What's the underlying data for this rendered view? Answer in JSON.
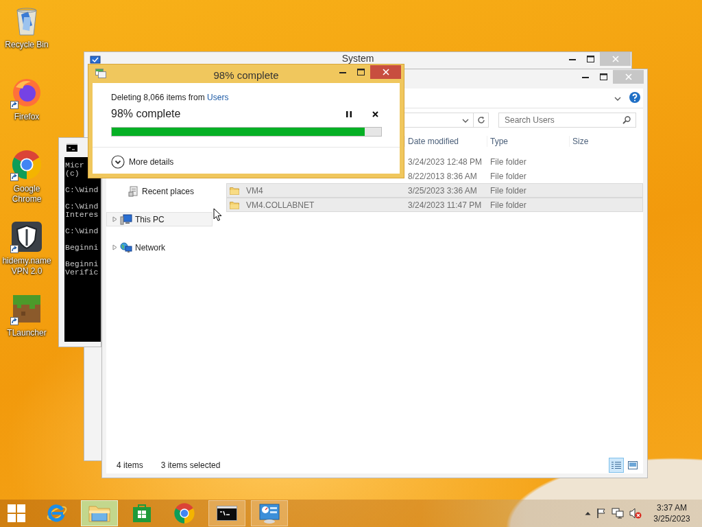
{
  "desktop_icons": [
    {
      "kind": "recycle-bin",
      "label": "Recycle Bin",
      "shortcut": false
    },
    {
      "kind": "firefox",
      "label": "Firefox",
      "shortcut": true
    },
    {
      "kind": "chrome",
      "label": "Google Chrome",
      "shortcut": true
    },
    {
      "kind": "vpn",
      "label": "hidemy.name VPN 2.0",
      "shortcut": true
    },
    {
      "kind": "tlauncher",
      "label": "TLauncher",
      "shortcut": true
    }
  ],
  "system_window": {
    "title": "System",
    "active": false
  },
  "console_window": {
    "active": false,
    "paragraphs": [
      [
        "Micr",
        "(c) "
      ],
      [
        "C:\\Wind"
      ],
      [
        "C:\\Wind",
        "Interes"
      ],
      [
        "C:\\Wind"
      ],
      [
        "Beginni"
      ],
      [
        "Beginni",
        "Verific"
      ]
    ]
  },
  "explorer": {
    "active": false,
    "search": {
      "placeholder": "Search Users"
    },
    "nav": [
      {
        "kind": "favorite",
        "label": "Recent places",
        "hovered": false
      },
      {
        "kind": "root",
        "label": "This PC",
        "expanded": false,
        "hovered": true
      },
      {
        "kind": "root",
        "label": "Network",
        "expanded": false,
        "hovered": false
      }
    ],
    "columns": [
      "Date modified",
      "Type",
      "Size"
    ],
    "rows": [
      {
        "date": "3/24/2023 12:48 PM",
        "type": "File folder",
        "selected": false
      },
      {
        "date": "8/22/2013 8:36 AM",
        "type": "File folder",
        "selected": false
      },
      {
        "name": "VM4",
        "date": "3/25/2023 3:36 AM",
        "type": "File folder",
        "selected": true
      },
      {
        "name": "VM4.COLLABNET",
        "date": "3/24/2023 11:47 PM",
        "type": "File folder",
        "selected": true
      }
    ],
    "status": {
      "count": "4 items",
      "selection": "3 items selected"
    },
    "view_buttons": [
      {
        "kind": "details",
        "selected": true
      },
      {
        "kind": "large-icons",
        "selected": false
      }
    ]
  },
  "dialog": {
    "active": true,
    "title": "98% complete",
    "message": "Deleting 8,066 items from",
    "source": "Users",
    "status": "98% complete",
    "progress": {
      "level": 0.94
    },
    "more_details": "More details"
  },
  "taskbar": {
    "apps": [
      {
        "open": false,
        "active": false
      },
      {
        "open": true,
        "active": true
      },
      {
        "open": false,
        "active": false
      },
      {
        "open": false,
        "active": false
      },
      {
        "open": true,
        "active": false
      },
      {
        "open": true,
        "active": false
      }
    ],
    "volume_muted": true,
    "clock": {
      "time": "3:37 AM",
      "date": "3/25/2023"
    }
  }
}
